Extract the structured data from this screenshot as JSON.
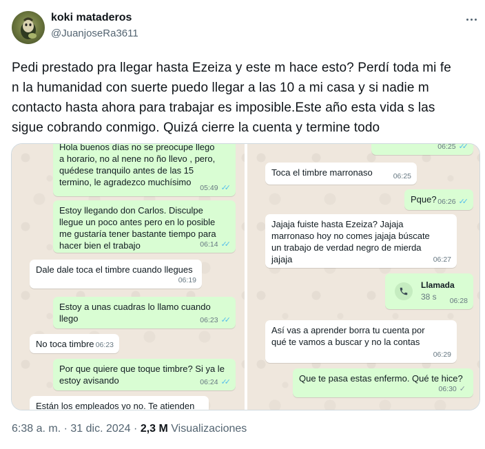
{
  "author": {
    "name": "koki mataderos",
    "handle": "@JuanjoseRa3611"
  },
  "tweet": {
    "text": "Pedi prestado pra llegar hasta Ezeiza y este m hace esto? Perdí toda mi fe\nn la humanidad con suerte puedo llegar a las 10 a mi casa y si nadie m\ncontacto hasta ahora para trabajar es imposible.Este año esta vida s las\nsigue cobrando conmigo. Quizá cierre la cuenta y termine todo"
  },
  "chat_left": {
    "messages": [
      {
        "dir": "out",
        "text": "Hola buenos días no se preocupe llego\na horario, no al nene no ño llevo , pero,\nquédese tranquilo antes de las 15\ntermino, le agradezco muchísimo",
        "time": "05:49",
        "ticks": "read"
      },
      {
        "dir": "out",
        "text": "Estoy llegando don Carlos. Disculpe\nllegue un poco antes pero en lo posible\nme gustaría tener bastante tiempo para\nhacer bien el trabajo",
        "time": "06:14",
        "ticks": "read"
      },
      {
        "dir": "in",
        "text": "Dale dale toca el timbre cuando llegues",
        "time": "06:19"
      },
      {
        "dir": "out",
        "text": "Estoy a unas cuadras lo llamo cuando\nllego",
        "time": "06:23",
        "ticks": "read"
      },
      {
        "dir": "in",
        "text": "No toca timbre",
        "time": "06:23"
      },
      {
        "dir": "out",
        "text": "Por que quiere que toque timbre? Si ya le\nestoy avisando",
        "time": "06:24",
        "ticks": "read"
      },
      {
        "dir": "in",
        "text": "Están los empleados yo no. Te atienden",
        "time": ""
      }
    ]
  },
  "chat_right": {
    "messages": [
      {
        "dir": "out",
        "text": "",
        "time": "06:25",
        "ticks": "read"
      },
      {
        "dir": "in",
        "text": "Toca el timbre marronaso",
        "time": "06:25"
      },
      {
        "dir": "out",
        "text": "Pque?",
        "time": "06:26",
        "ticks": "read"
      },
      {
        "dir": "in",
        "text": "Jajaja fuiste hasta Ezeiza? Jajaja\nmarronaso hoy no comes jajaja búscate\nun trabajo de verdad negro de mierda\njajaja",
        "time": "06:27"
      },
      {
        "dir": "out",
        "call": true,
        "call_label": "Llamada",
        "call_duration": "38 s",
        "time": "06:28"
      },
      {
        "dir": "in",
        "text": "Así vas a aprender borra tu cuenta por\nqué te vamos a buscar y no la contas",
        "time": "06:29"
      },
      {
        "dir": "out",
        "text": "Que te pasa estas enfermo. Qué te hice?",
        "time": "06:30",
        "ticks": "sent"
      }
    ]
  },
  "footer": {
    "time": "6:38 a. m.",
    "sep": "·",
    "date": "31 dic. 2024",
    "views_count": "2,3 M",
    "views_label": "Visualizaciones"
  },
  "icons": {
    "more": "more-icon",
    "read_ticks": "double-check-icon",
    "sent_tick": "single-check-icon",
    "call": "phone-call-icon"
  },
  "colors": {
    "outgoing_bubble": "#d9fdd3",
    "incoming_bubble": "#ffffff",
    "chat_background": "#efe7dd",
    "read_tick": "#53bdeb",
    "secondary_text": "#536471"
  }
}
